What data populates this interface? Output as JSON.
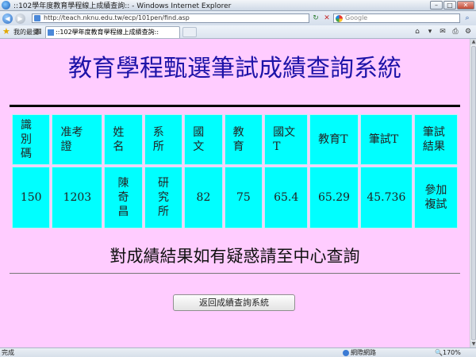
{
  "window": {
    "title": "::102學年度教育學程線上成績查詢:: - Windows Internet Explorer",
    "minimize": "–",
    "maximize": "□",
    "close": "✕"
  },
  "address_bar": {
    "back": "◀",
    "forward": "▶",
    "url": "http://teach.nknu.edu.tw/ecp/101pen/find.asp",
    "refresh": "↻",
    "stop": "✕",
    "search_placeholder": "Google",
    "search_go": "⌕"
  },
  "favorites_bar": {
    "star": "★",
    "label": "我的最愛",
    "tab_grid": "▦",
    "tab_title": "::102學年度教育學程線上成績查詢::"
  },
  "command_icons": [
    "⌂",
    "▾",
    "✉",
    "⎙",
    "⚙"
  ],
  "page": {
    "title": "教育學程甄選筆試成績查詢系統",
    "table": {
      "headers": [
        "識別碼",
        "准考證",
        "姓名",
        "系所",
        "國文",
        "教育",
        "國文T",
        "教育T",
        "筆試T",
        "筆試結果"
      ],
      "row": [
        "150",
        "1203",
        "陳奇昌",
        "研究所",
        "82",
        "75",
        "65.4",
        "65.29",
        "45.736",
        "參加複試"
      ]
    },
    "notice": "對成績結果如有疑惑請至中心查詢",
    "back_button": "返回成績查詢系統"
  },
  "status_bar": {
    "status": "完成",
    "zone": "網際網路",
    "zoom": "170%",
    "zoom_icon": "🔍"
  },
  "colors": {
    "page_background": "#ffccff",
    "title_color": "#1d13a8",
    "cell_background": "#00ffff"
  }
}
